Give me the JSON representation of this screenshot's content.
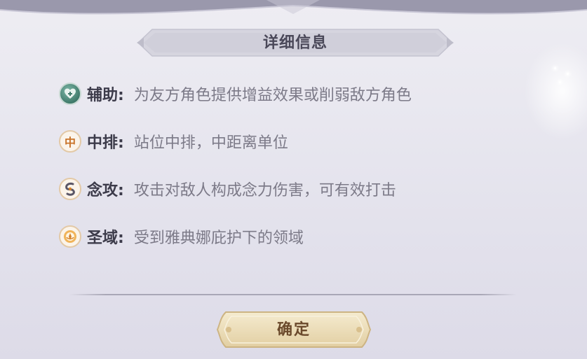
{
  "dialog": {
    "title": "详细信息",
    "confirm_label": "确定"
  },
  "traits": [
    {
      "icon": "support-heart-icon",
      "label": "辅助:",
      "description": "为友方角色提供增益效果或削弱敌方角色"
    },
    {
      "icon": "middle-row-icon",
      "icon_glyph": "中",
      "label": "中排:",
      "description": "站位中排，中距离单位"
    },
    {
      "icon": "psychic-attack-swirl-icon",
      "label": "念攻:",
      "description": "攻击对敌人构成念力伤害，可有效打击"
    },
    {
      "icon": "sanctuary-athena-icon",
      "label": "圣域:",
      "description": "受到雅典娜庇护下的领域"
    }
  ],
  "colors": {
    "panel_bg": "#e6e5ee",
    "label_text": "#3c3b4a",
    "desc_text": "#7c7a88",
    "button_gold": "#e9d9b4",
    "button_text": "#6b4a2c",
    "support_icon_teal": "#4f8f7e",
    "orange_icon_accent": "#d4822b"
  }
}
